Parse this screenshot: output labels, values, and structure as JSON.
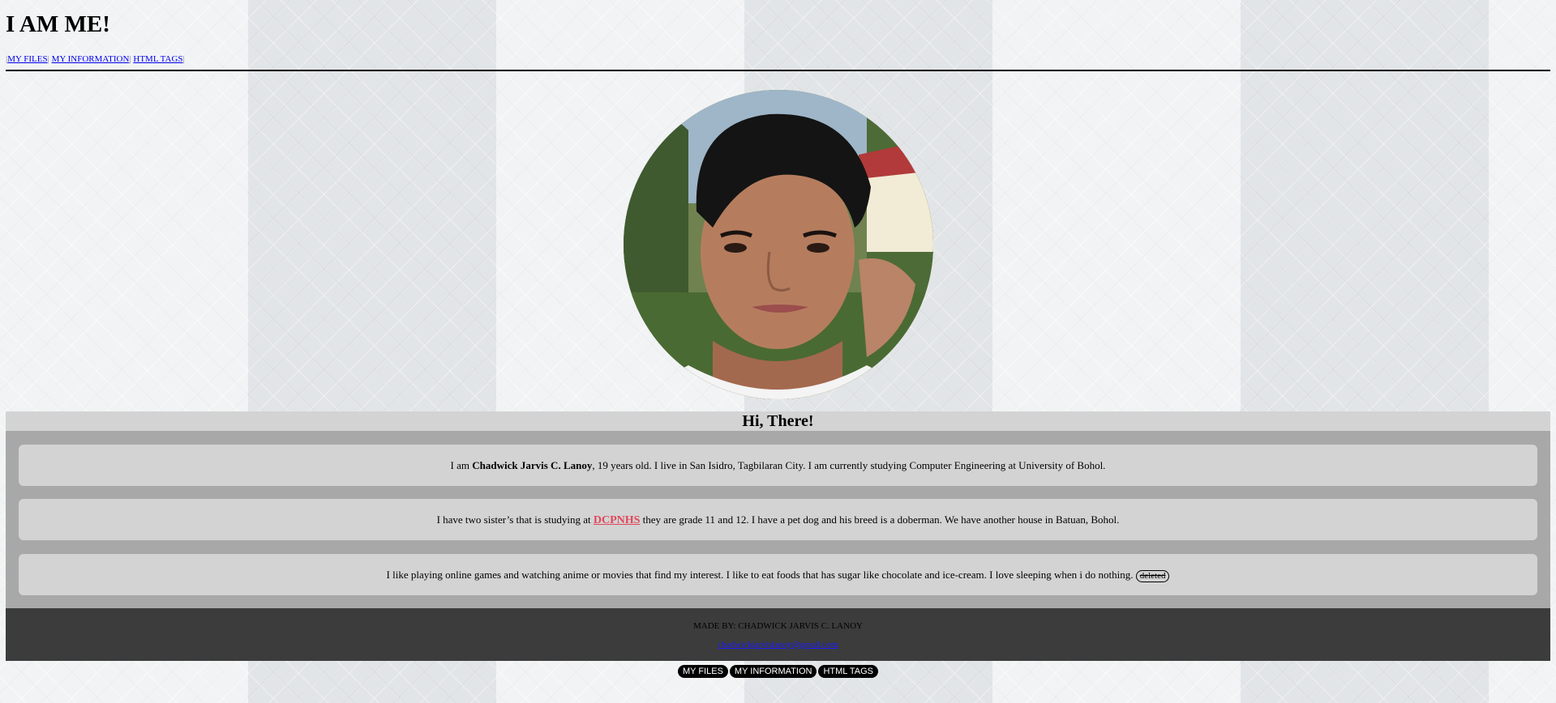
{
  "header": {
    "title": "I AM ME!"
  },
  "top_nav": {
    "links": [
      "MY FILES",
      "MY INFORMATION",
      "HTML TAGS"
    ],
    "separator": "|"
  },
  "main": {
    "greeting": "Hi, There!",
    "p1": {
      "pre": "I am ",
      "name": "Chadwick Jarvis C. Lanoy",
      "post": ", 19 years old. I live in San Isidro, Tagbilaran City. I am currently studying Computer Engineering at University of Bohol."
    },
    "p2": {
      "pre": "I have two sister’s that is studying at ",
      "school": "DCPNHS",
      "post": " they are grade 11 and 12. I have a pet dog and his breed is a doberman. We have another house in Batuan, Bohol."
    },
    "p3": {
      "text": "I like playing online games and watching anime or movies that find my interest. I like to eat foods that has sugar like chocolate and ice-cream. I love sleeping when i do nothing. ",
      "deleted": "deleted"
    }
  },
  "footer": {
    "made_by": "MADE BY: CHADWICK JARVIS C. LANOY",
    "email": "chadwickjarvislanoy@gmail.com"
  },
  "bottom_nav": {
    "links": [
      "MY FILES",
      "MY INFORMATION",
      "HTML TAGS"
    ]
  },
  "colors": {
    "school_link": "#e0475b",
    "footer_bg": "#3c3c3c",
    "content_bg": "#a8a8a8",
    "panel_bg": "#d3d3d3"
  }
}
